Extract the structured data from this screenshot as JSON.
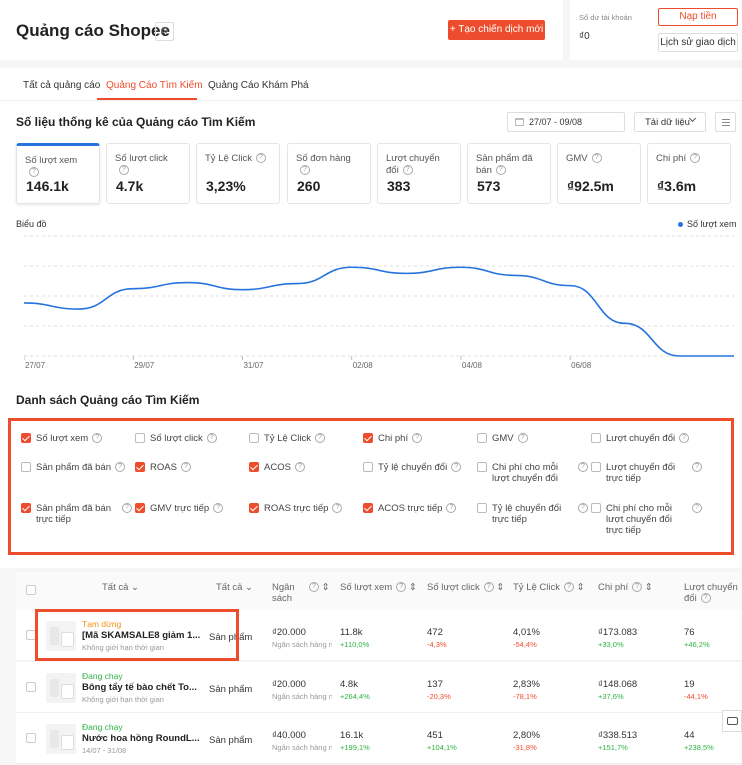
{
  "header": {
    "title": "Quảng cáo Shopee",
    "create_btn": "+ Tạo chiến dịch mới"
  },
  "balance": {
    "label": "Số dư tài khoản",
    "value": "₫0",
    "topup_btn": "Nạp tiền",
    "history_btn": "Lịch sử giao dịch"
  },
  "tabs": [
    "Tất cả quảng cáo",
    "Quảng Cáo Tìm Kiếm",
    "Quảng Cáo Khám Phá"
  ],
  "stats": {
    "title": "Số liệu thống kê của Quảng cáo Tìm Kiếm",
    "date_range": "27/07 - 09/08",
    "download_btn": "Tải dữ liệu",
    "metrics": [
      {
        "label": "Số lượt xem",
        "value": "146.1k"
      },
      {
        "label": "Số lượt click",
        "value": "4.7k"
      },
      {
        "label": "Tỷ Lệ Click",
        "value": "3,23%"
      },
      {
        "label": "Số đơn hàng",
        "value": "260"
      },
      {
        "label": "Lượt chuyển đổi",
        "value": "383"
      },
      {
        "label": "Sản phẩm đã bán",
        "value": "573"
      },
      {
        "label": "GMV",
        "value": "₫92.5m"
      },
      {
        "label": "Chi phí",
        "value": "₫3.6m"
      }
    ]
  },
  "chart_label": "Biểu đồ",
  "chart_data": {
    "type": "line",
    "legend": "Số lượt xem",
    "x": [
      "27/07",
      "28/07",
      "29/07",
      "30/07",
      "31/07",
      "01/08",
      "02/08",
      "03/08",
      "04/08",
      "05/08",
      "06/08",
      "07/08",
      "08/08",
      "09/08"
    ],
    "ticks": [
      "27/07",
      "29/07",
      "31/07",
      "02/08",
      "04/08",
      "06/08"
    ],
    "values": [
      0.52,
      0.46,
      0.66,
      0.72,
      0.65,
      0.71,
      0.87,
      0.81,
      0.87,
      0.79,
      0.69,
      0.32,
      0.0,
      0.0
    ],
    "color": "#2673dd",
    "grid": true
  },
  "list": {
    "title": "Danh sách Quảng cáo Tìm Kiếm",
    "columns_options": [
      {
        "label": "Số lượt xem",
        "checked": true
      },
      {
        "label": "Số lượt click",
        "checked": false
      },
      {
        "label": "Tỷ Lệ Click",
        "checked": false
      },
      {
        "label": "Chi phí",
        "checked": true
      },
      {
        "label": "GMV",
        "checked": false
      },
      {
        "label": "Lượt chuyển đổi",
        "checked": false
      },
      {
        "label": "Sản phẩm đã bán",
        "checked": false
      },
      {
        "label": "ROAS",
        "checked": true
      },
      {
        "label": "ACOS",
        "checked": true
      },
      {
        "label": "Tỷ lệ chuyển đổi",
        "checked": false
      },
      {
        "label": "Chi phí cho mỗi lượt chuyển đổi",
        "checked": false
      },
      {
        "label": "Lượt chuyển đổi trực tiếp",
        "checked": false
      },
      {
        "label": "Sản phẩm đã bán trực tiếp",
        "checked": true
      },
      {
        "label": "GMV trực tiếp",
        "checked": true
      },
      {
        "label": "ROAS trực tiếp",
        "checked": true
      },
      {
        "label": "ACOS trực tiếp",
        "checked": true
      },
      {
        "label": "Tỷ lệ chuyển đổi trực tiếp",
        "checked": false
      },
      {
        "label": "Chi phí cho mỗi lượt chuyển đổi trực tiếp",
        "checked": false
      }
    ],
    "headers": [
      "Tất cả",
      "Tất cả",
      "Ngân sách",
      "Số lượt xem",
      "Số lượt click",
      "Tỷ Lệ Click",
      "Chi phí",
      "Lượt chuyển đổi"
    ],
    "rows": [
      {
        "status": "Tạm dừng",
        "status_color": "#f69113",
        "name": "[Mã SKAMSALE8 giảm 1...",
        "time": "Không giới hạn thời gian",
        "type": "Sản phẩm",
        "budget": "₫20.000",
        "budget_sub": "Ngân sách hàng ngày",
        "views": "11.8k",
        "views_d": "+110,0%",
        "views_up": true,
        "clicks": "472",
        "clicks_d": "-4,3%",
        "clicks_up": false,
        "ctr": "4,01%",
        "ctr_d": "-54,4%",
        "ctr_up": false,
        "cost": "₫173.083",
        "cost_d": "+33,0%",
        "cost_up": true,
        "conv": "76",
        "conv_d": "+46,2%",
        "conv_up": true
      },
      {
        "status": "Đang chạy",
        "status_color": "#2fb344",
        "name": "Bông tẩy tế bào chết To...",
        "time": "Không giới hạn thời gian",
        "type": "Sản phẩm",
        "budget": "₫20.000",
        "budget_sub": "Ngân sách hàng ngày",
        "views": "4.8k",
        "views_d": "+264,4%",
        "views_up": true,
        "clicks": "137",
        "clicks_d": "-20,3%",
        "clicks_up": false,
        "ctr": "2,83%",
        "ctr_d": "-78,1%",
        "ctr_up": false,
        "cost": "₫148.068",
        "cost_d": "+37,6%",
        "cost_up": true,
        "conv": "19",
        "conv_d": "-44,1%",
        "conv_up": false
      },
      {
        "status": "Đang chạy",
        "status_color": "#2fb344",
        "name": "Nước hoa hồng RoundL...",
        "time": "14/07 - 31/08",
        "type": "Sản phẩm",
        "budget": "₫40.000",
        "budget_sub": "Ngân sách hàng ngày",
        "views": "16.1k",
        "views_d": "+199,1%",
        "views_up": true,
        "clicks": "451",
        "clicks_d": "+104,1%",
        "clicks_up": true,
        "ctr": "2,80%",
        "ctr_d": "-31,8%",
        "ctr_up": false,
        "cost": "₫338.513",
        "cost_d": "+151,7%",
        "cost_up": true,
        "conv": "44",
        "conv_d": "+238,5%",
        "conv_up": true
      }
    ]
  }
}
